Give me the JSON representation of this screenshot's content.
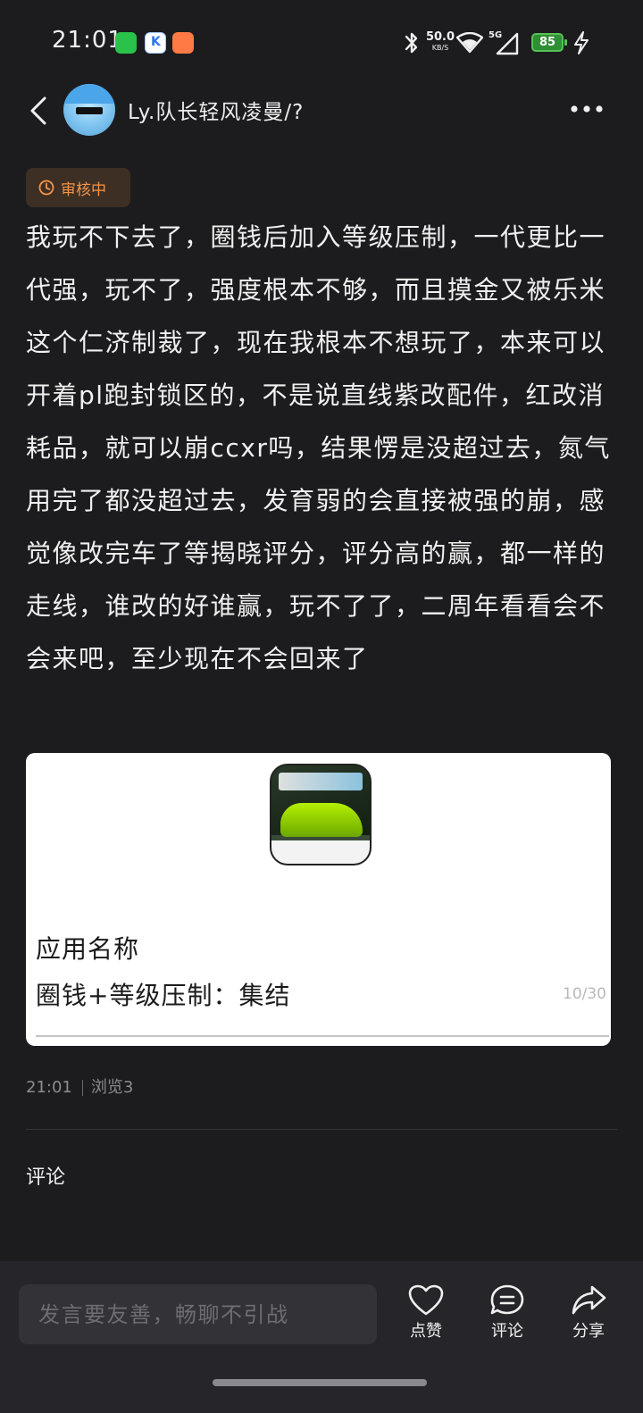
{
  "status_bar": {
    "time": "21:01",
    "net_speed_value": "50.0",
    "net_speed_unit": "KB/S",
    "network_type": "5G",
    "battery": "85",
    "icons": [
      "wechat-icon",
      "k-app-icon",
      "game-app-icon",
      "bluetooth-icon",
      "wifi-icon",
      "signal-icon",
      "battery-icon",
      "charging-icon"
    ]
  },
  "header": {
    "username": "Ly.队长轻风凌曼/?",
    "icons": [
      "back-icon",
      "avatar",
      "more-icon"
    ]
  },
  "post": {
    "review_status": "审核中",
    "content": "我玩不下去了，圈钱后加入等级压制，一代更比一代强，玩不了，强度根本不够，而且摸金又被乐米这个仁济制裁了，现在我根本不想玩了，本来可以开着pl跑封锁区的，不是说直线紫改配件，红改消耗品，就可以崩ccxr吗，结果愣是没超过去，氮气用完了都没超过去，发育弱的会直接被强的崩，感觉像改完车了等揭晓评分，评分高的赢，都一样的走线，谁改的好谁赢，玩不了了，二周年看看会不会来吧，至少现在不会回来了",
    "app_card": {
      "app_name_label": "应用名称",
      "app_name_value": "圈钱+等级压制：集结",
      "char_count": "10/30",
      "game_icon": "game-icon"
    },
    "meta": {
      "time": "21:01",
      "views": "浏览3"
    },
    "comments_title": "评论"
  },
  "bottom_bar": {
    "input_placeholder": "发言要友善，畅聊不引战",
    "like_label": "点赞",
    "comment_label": "评论",
    "share_label": "分享"
  },
  "colors": {
    "background": "#1c1c1e",
    "review_badge_text": "#f59449",
    "review_badge_bg": "#3d2f24",
    "battery_green": "#56c255",
    "bottom_bar": "#26262a"
  }
}
